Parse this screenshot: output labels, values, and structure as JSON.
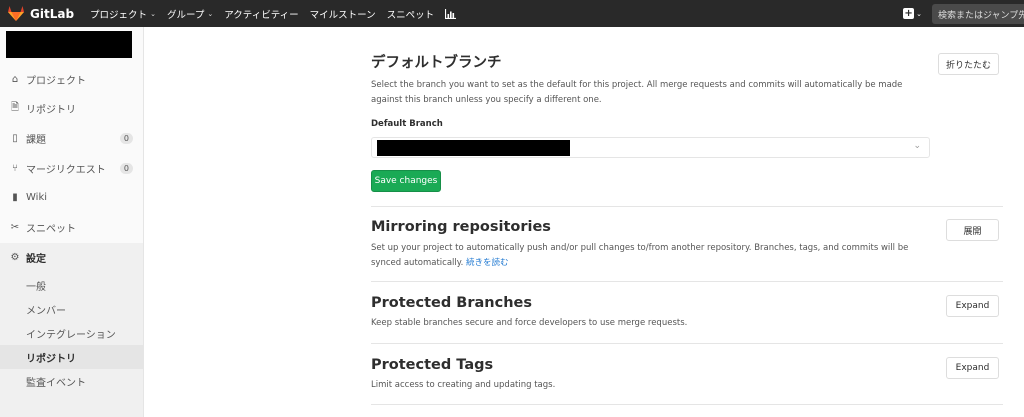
{
  "topbar": {
    "brand": "GitLab",
    "nav": [
      {
        "label": "プロジェクト",
        "dropdown": true
      },
      {
        "label": "グループ",
        "dropdown": true
      },
      {
        "label": "アクティビティー",
        "dropdown": false
      },
      {
        "label": "マイルストーン",
        "dropdown": false
      },
      {
        "label": "スニペット",
        "dropdown": false
      }
    ],
    "chart_icon": "chart-icon",
    "new_icon": "plus-square-icon",
    "search_placeholder": "検索またはジャンプ先"
  },
  "sidebar": {
    "items": [
      {
        "label": "プロジェクト",
        "icon": "home-icon"
      },
      {
        "label": "リポジトリ",
        "icon": "file-icon"
      },
      {
        "label": "課題",
        "icon": "issues-icon",
        "count": "0"
      },
      {
        "label": "マージリクエスト",
        "icon": "merge-request-icon",
        "count": "0"
      },
      {
        "label": "Wiki",
        "icon": "book-icon"
      },
      {
        "label": "スニペット",
        "icon": "scissors-icon"
      }
    ],
    "settings": {
      "label": "設定",
      "icon": "gear-icon",
      "sub": [
        {
          "label": "一般"
        },
        {
          "label": "メンバー"
        },
        {
          "label": "インテグレーション"
        },
        {
          "label": "リポジトリ",
          "active": true
        },
        {
          "label": "監査イベント"
        }
      ]
    }
  },
  "main": {
    "default_branch": {
      "title": "デフォルトブランチ",
      "description": "Select the branch you want to set as the default for this project. All merge requests and commits will automatically be made against this branch unless you specify a different one.",
      "collapse_label": "折りたたむ",
      "field_label": "Default Branch",
      "save_label": "Save changes"
    },
    "mirroring": {
      "title": "Mirroring repositories",
      "description": "Set up your project to automatically push and/or pull changes to/from another repository. Branches, tags, and commits will be synced automatically.",
      "read_more": "続きを読む",
      "expand_label": "展開"
    },
    "protected_branches": {
      "title": "Protected Branches",
      "description": "Keep stable branches secure and force developers to use merge requests.",
      "expand_label": "Expand"
    },
    "protected_tags": {
      "title": "Protected Tags",
      "description": "Limit access to creating and updating tags.",
      "expand_label": "Expand"
    }
  }
}
